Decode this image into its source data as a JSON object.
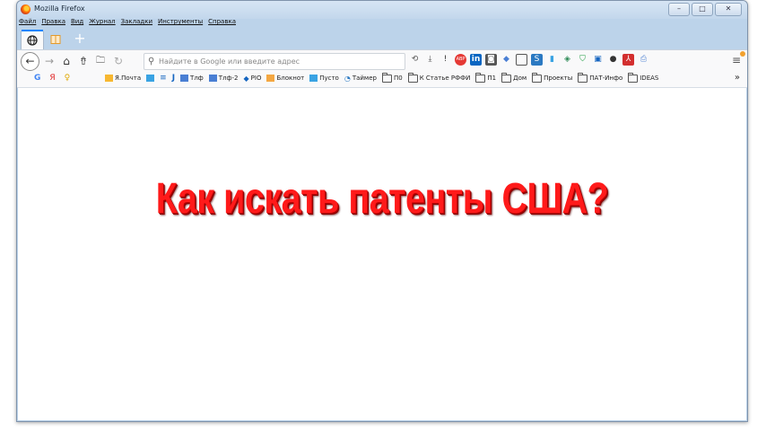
{
  "window": {
    "title": "Mozilla Firefox",
    "controls": [
      "minimize",
      "maximize",
      "close"
    ]
  },
  "menu": [
    "Файл",
    "Правка",
    "Вид",
    "Журнал",
    "Закладки",
    "Инструменты",
    "Справка"
  ],
  "tabs": [
    {
      "icon": "globe-icon",
      "active": true
    },
    {
      "icon": "reader-icon",
      "active": false
    }
  ],
  "url": {
    "placeholder": "Найдите в Google или введите адрес",
    "value": ""
  },
  "bookmarks": [
    {
      "label": "Я.Почта",
      "icon": "mail-icon"
    },
    {
      "label": "Тлф",
      "icon": "phone-icon"
    },
    {
      "label": "Тлф-2",
      "icon": "phone-icon"
    },
    {
      "label": "PIO",
      "icon": "diamond-icon"
    },
    {
      "label": "Блокнот",
      "icon": "notepad-icon"
    },
    {
      "label": "Пусто",
      "icon": "page-icon"
    },
    {
      "label": "Таймер",
      "icon": "timer-icon"
    },
    {
      "label": "П0",
      "icon": "folder-icon"
    },
    {
      "label": "К Статье РФФИ",
      "icon": "folder-icon"
    },
    {
      "label": "П1",
      "icon": "folder-icon"
    },
    {
      "label": "Дом",
      "icon": "folder-icon"
    },
    {
      "label": "Проекты",
      "icon": "folder-icon"
    },
    {
      "label": "ПАТ-Инфо",
      "icon": "folder-icon"
    },
    {
      "label": "IDEAS",
      "icon": "folder-icon"
    }
  ],
  "content": {
    "headline": "Как искать патенты США?",
    "headline_color": "#ff1a1a"
  }
}
